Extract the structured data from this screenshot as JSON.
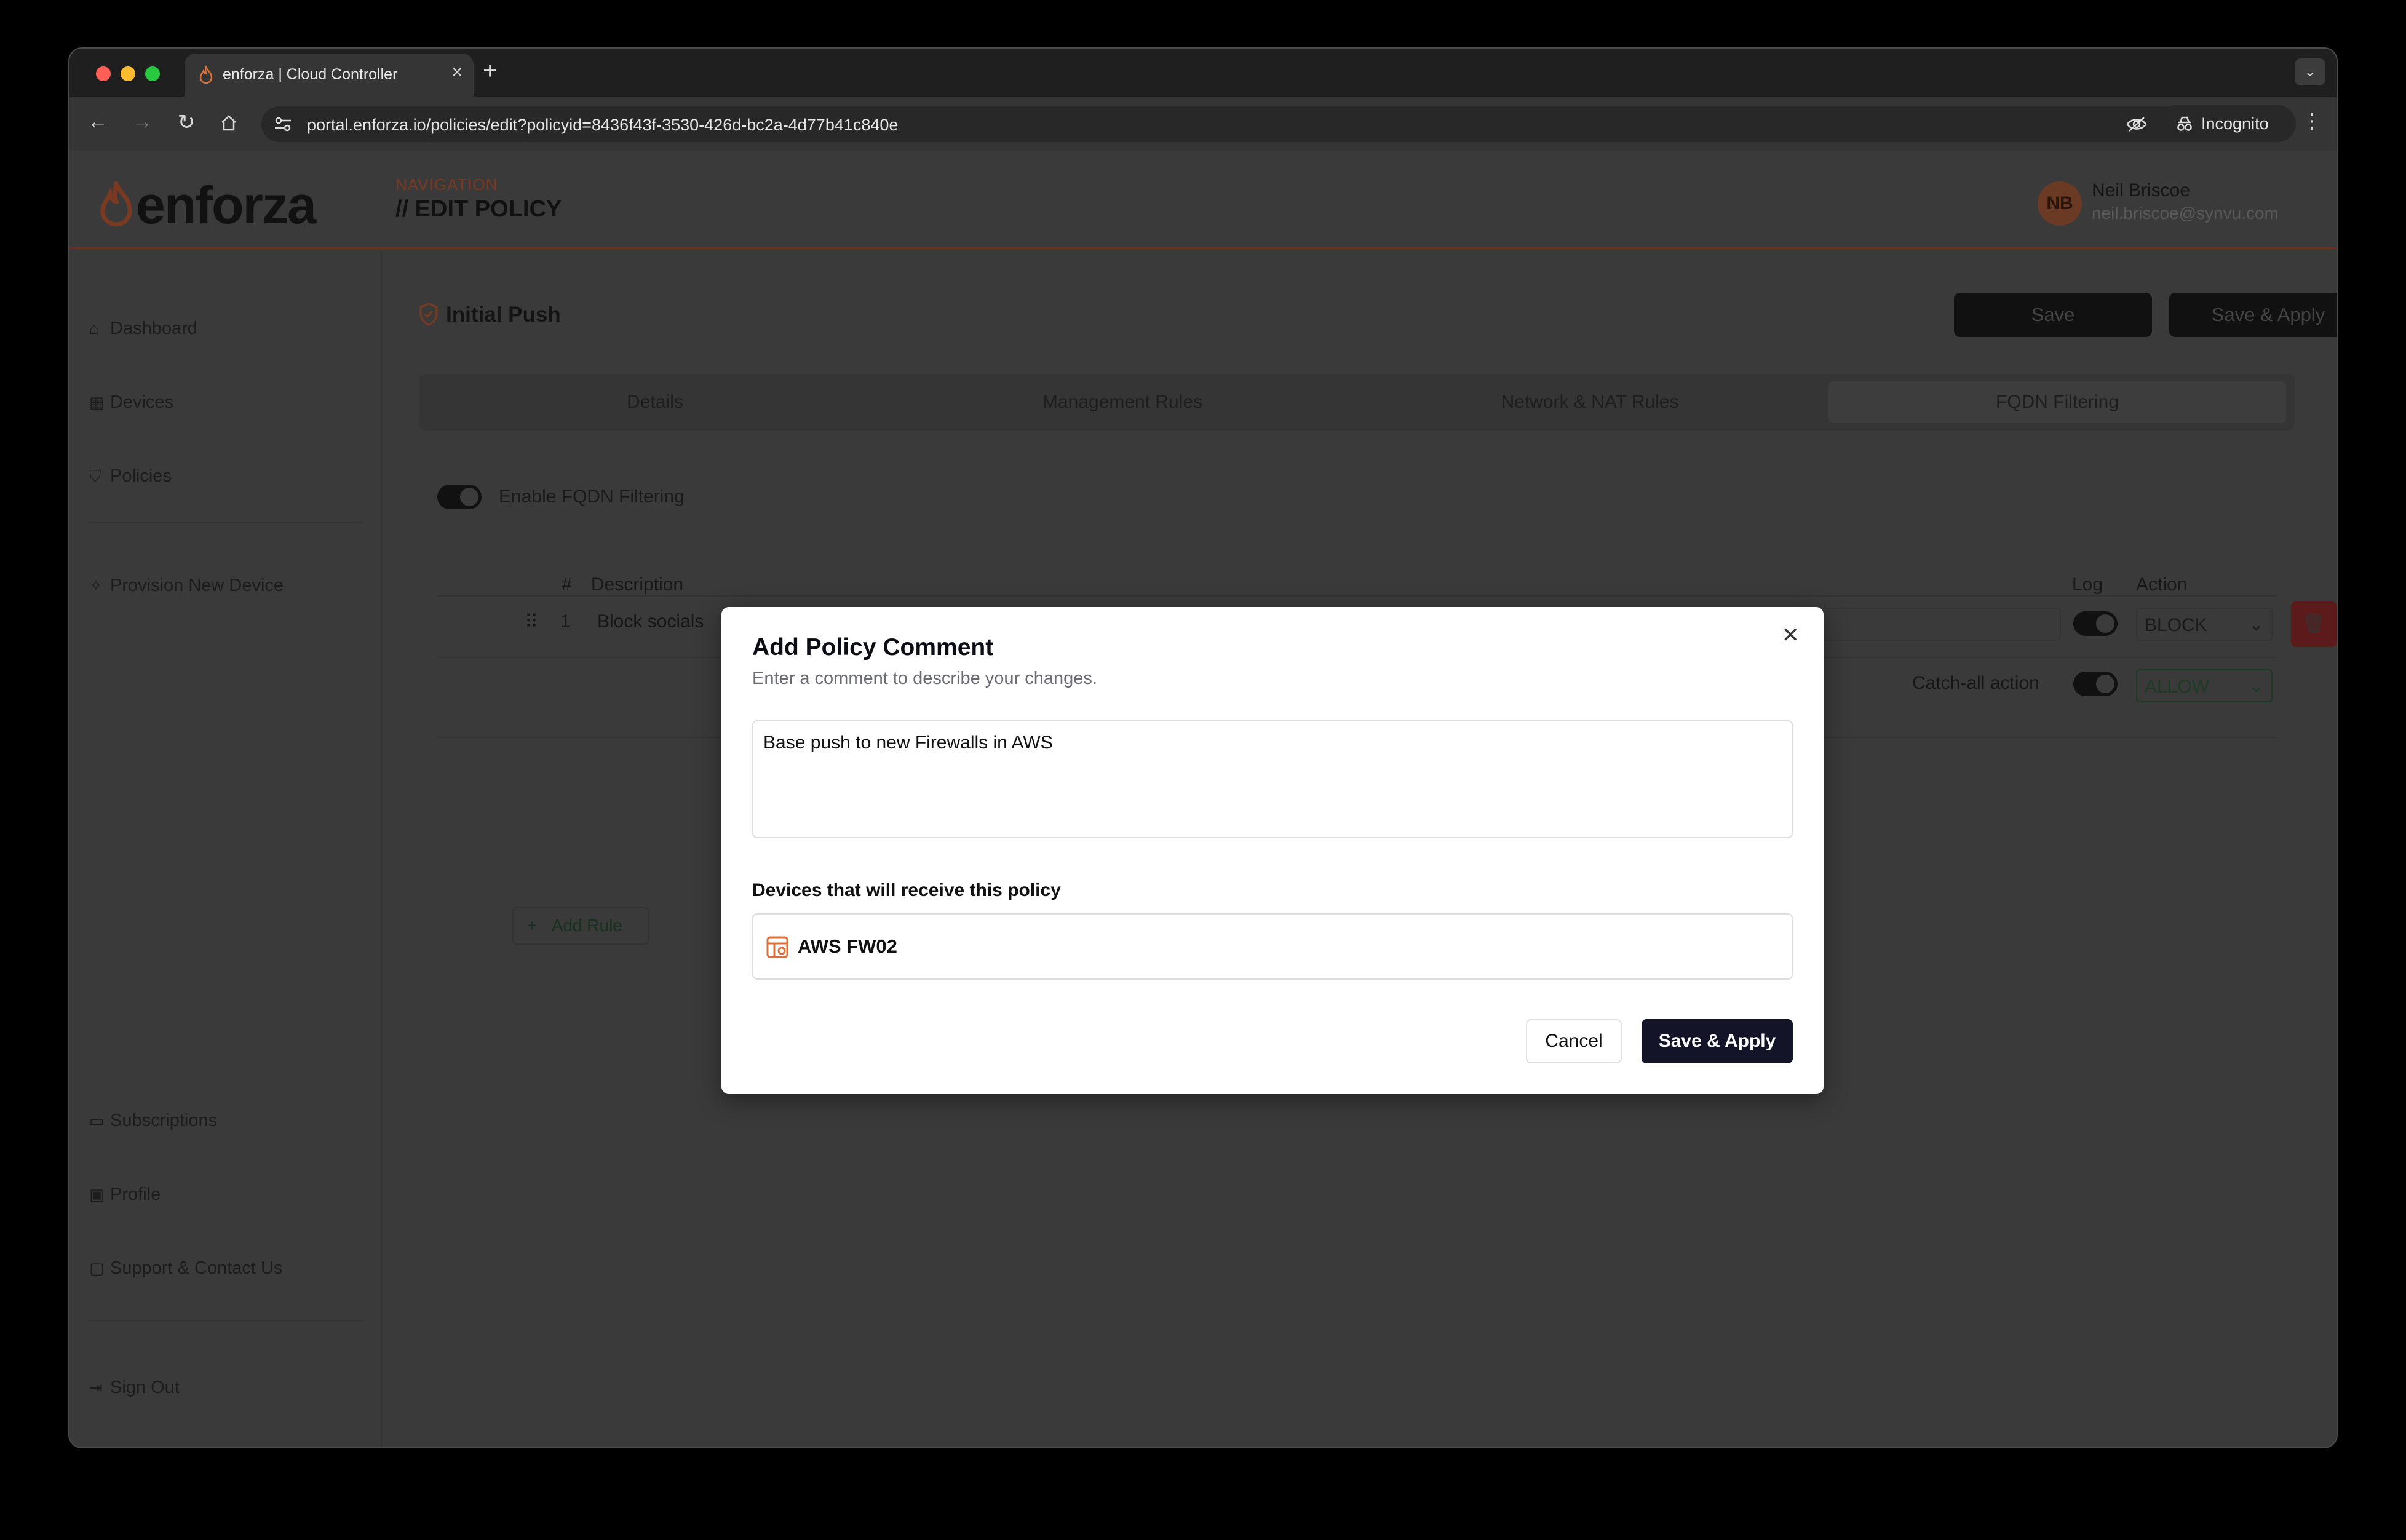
{
  "browser": {
    "tab_title": "enforza | Cloud Controller",
    "tab_close": "×",
    "new_tab": "+",
    "url": "portal.enforza.io/policies/edit?policyid=8436f43f-3530-426d-bc2a-4d77b41c840e",
    "incognito_label": "Incognito",
    "colors": {
      "close": "#ff5f57",
      "minimize": "#febc2e",
      "maximize": "#28c840"
    }
  },
  "header": {
    "logo_text": "enforza",
    "nav_label": "NAVIGATION",
    "page_title": "// EDIT POLICY",
    "user_initials": "NB",
    "user_name": "Neil Briscoe",
    "user_email": "neil.briscoe@synvu.com"
  },
  "sidebar": {
    "items": [
      {
        "label": "Dashboard",
        "icon": "home-icon"
      },
      {
        "label": "Devices",
        "icon": "devices-icon"
      },
      {
        "label": "Policies",
        "icon": "shield-icon"
      },
      {
        "label": "Provision New Device",
        "icon": "sparkle-icon"
      },
      {
        "label": "Subscriptions",
        "icon": "credit-card-icon"
      },
      {
        "label": "Profile",
        "icon": "profile-icon"
      },
      {
        "label": "Support & Contact Us",
        "icon": "chat-icon"
      },
      {
        "label": "Sign Out",
        "icon": "sign-out-icon"
      }
    ]
  },
  "main": {
    "policy_name": "Initial Push",
    "save_label": "Save",
    "save_apply_label": "Save & Apply",
    "tabs": [
      "Details",
      "Management Rules",
      "Network & NAT Rules",
      "FQDN Filtering"
    ],
    "active_tab": "FQDN Filtering",
    "enable_label": "Enable FQDN Filtering",
    "table": {
      "headers": {
        "num": "#",
        "description": "Description",
        "log": "Log",
        "action": "Action"
      },
      "rows": [
        {
          "num": "1",
          "description": "Block socials",
          "action": "BLOCK"
        }
      ],
      "catch_all_label": "Catch-all action",
      "catch_all_value": "ALLOW"
    },
    "add_rule_label": "Add Rule"
  },
  "modal": {
    "title": "Add Policy Comment",
    "subtitle": "Enter a comment to describe your changes.",
    "comment_value": "Base push to new Firewalls in AWS",
    "devices_label": "Devices that will receive this policy",
    "devices": [
      "AWS FW02"
    ],
    "cancel_label": "Cancel",
    "apply_label": "Save & Apply"
  }
}
